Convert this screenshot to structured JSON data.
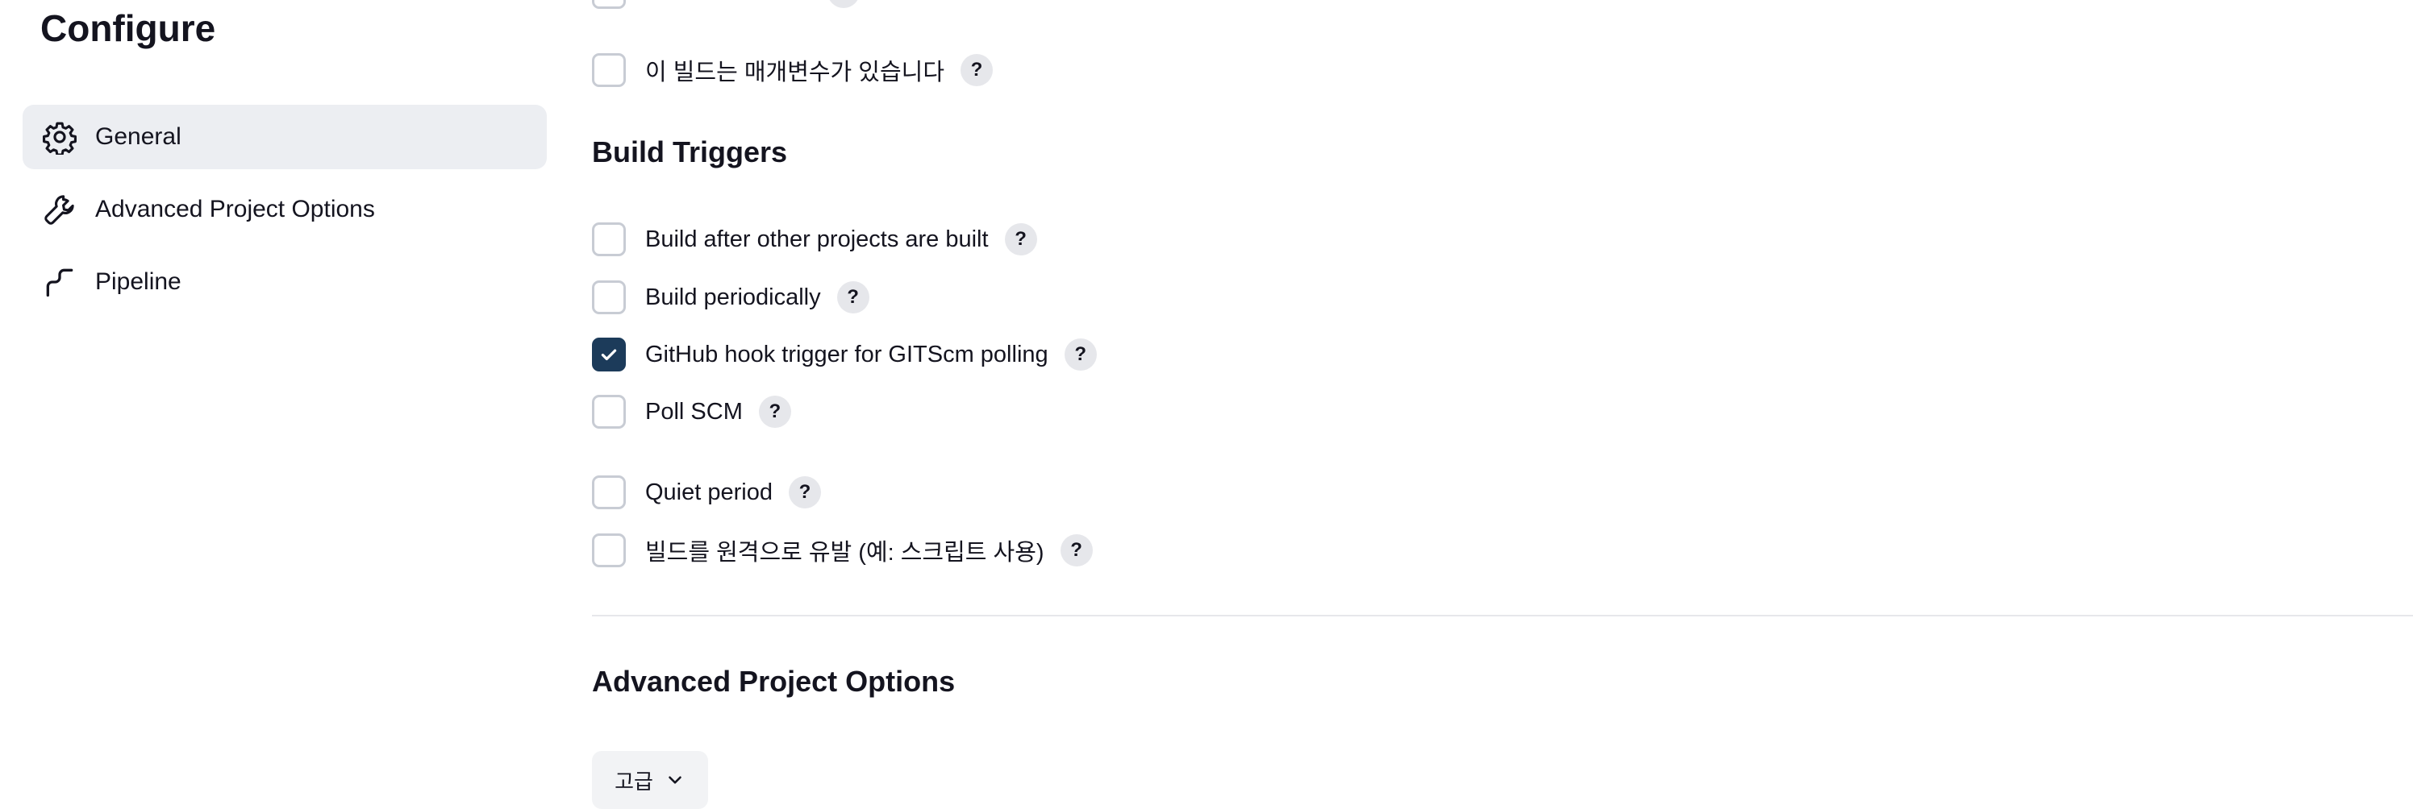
{
  "page": {
    "title": "Configure"
  },
  "sidebar": {
    "items": [
      {
        "label": "General",
        "icon": "gear-icon",
        "active": true
      },
      {
        "label": "Advanced Project Options",
        "icon": "wrench-icon",
        "active": false
      },
      {
        "label": "Pipeline",
        "icon": "pipeline-icon",
        "active": false
      }
    ]
  },
  "general": {
    "parameterized_label": "이 빌드는 매개변수가 있습니다",
    "parameterized_checked": false
  },
  "build_triggers": {
    "title": "Build Triggers",
    "options": [
      {
        "label": "Build after other projects are built",
        "checked": false
      },
      {
        "label": "Build periodically",
        "checked": false
      },
      {
        "label": "GitHub hook trigger for GITScm polling",
        "checked": true
      },
      {
        "label": "Poll SCM",
        "checked": false
      },
      {
        "label": "Quiet period",
        "checked": false
      },
      {
        "label": "빌드를 원격으로 유발 (예: 스크립트 사용)",
        "checked": false
      }
    ]
  },
  "advanced": {
    "title": "Advanced Project Options",
    "button_label": "고급"
  },
  "help_glyph": "?",
  "colors": {
    "checked_fill": "#1c3b5a",
    "active_sidebar_bg": "#eceef2",
    "help_bg": "#e6e7eb"
  }
}
